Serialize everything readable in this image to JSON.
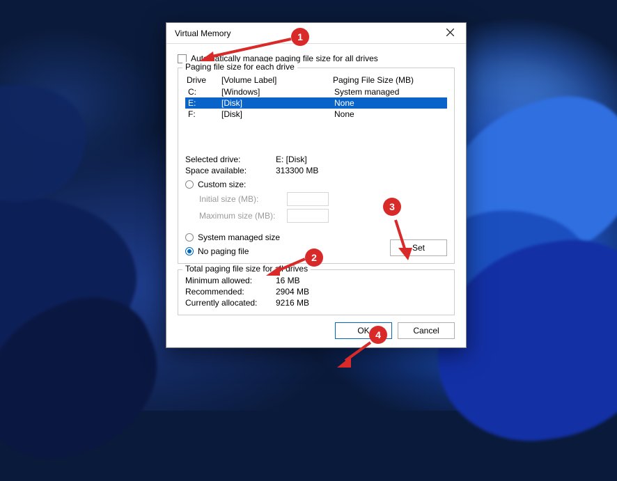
{
  "dialog": {
    "title": "Virtual Memory",
    "auto_manage_label": "Automatically manage paging file size for all drives",
    "auto_manage_checked": false
  },
  "group_drives": {
    "title": "Paging file size for each drive",
    "col_drive": "Drive",
    "col_volume": "[Volume Label]",
    "col_size": "Paging File Size (MB)",
    "rows": [
      {
        "d": "C:",
        "v": "[Windows]",
        "s": "System managed",
        "selected": false
      },
      {
        "d": "E:",
        "v": "[Disk]",
        "s": "None",
        "selected": true
      },
      {
        "d": "F:",
        "v": "[Disk]",
        "s": "None",
        "selected": false
      }
    ],
    "selected_drive_label": "Selected drive:",
    "selected_drive_value": "E:  [Disk]",
    "space_available_label": "Space available:",
    "space_available_value": "313300 MB",
    "radio_custom": "Custom size:",
    "initial_label": "Initial size (MB):",
    "maximum_label": "Maximum size (MB):",
    "radio_system": "System managed size",
    "radio_nopaging": "No paging file",
    "selected_radio": "nopaging",
    "set_button": "Set"
  },
  "group_total": {
    "title": "Total paging file size for all drives",
    "min_label": "Minimum allowed:",
    "min_value": "16 MB",
    "rec_label": "Recommended:",
    "rec_value": "2904 MB",
    "cur_label": "Currently allocated:",
    "cur_value": "9216 MB"
  },
  "buttons": {
    "ok": "OK",
    "cancel": "Cancel"
  },
  "markers": {
    "m1": "1",
    "m2": "2",
    "m3": "3",
    "m4": "4"
  }
}
